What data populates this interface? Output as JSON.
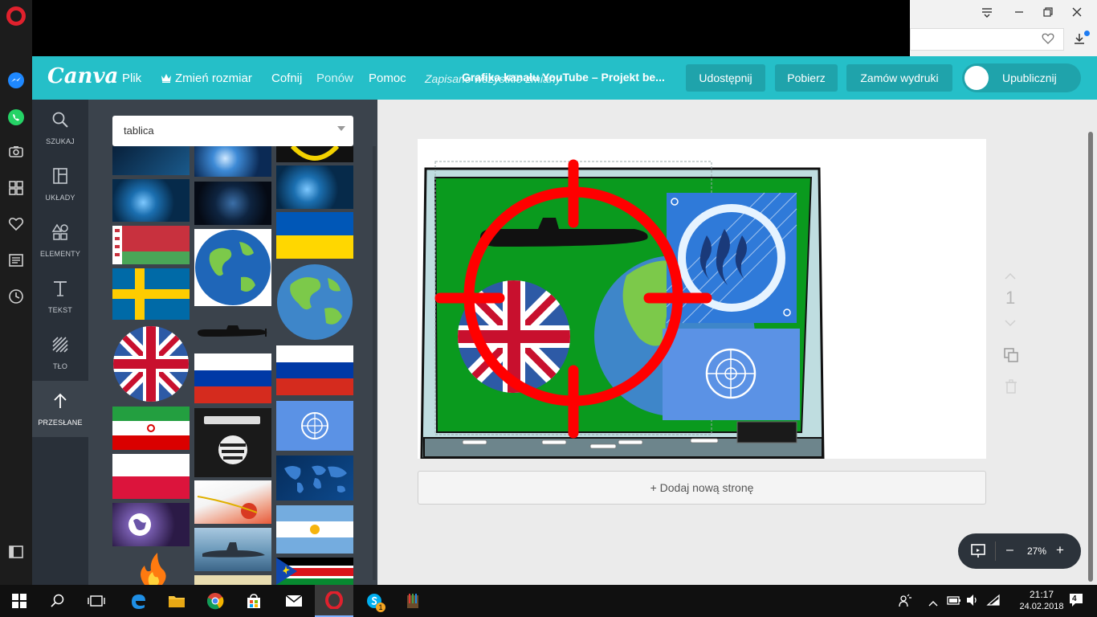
{
  "browser": {
    "accent": "#e0212d"
  },
  "header": {
    "logo": "Canva",
    "menu": {
      "file": "Plik",
      "resize": "Zmień rozmiar",
      "undo": "Cofnij",
      "redo": "Ponów",
      "help": "Pomoc"
    },
    "saved_status": "Zapisano wszystkie zmiany",
    "doc_title": "Grafika kanału YouTube – Projekt be...",
    "buttons": {
      "share": "Udostępnij",
      "download": "Pobierz",
      "order_prints": "Zamów wydruki",
      "publish": "Upublicznij"
    },
    "accent": "#25bfc8"
  },
  "left_nav": {
    "items": [
      {
        "label": "SZUKAJ",
        "icon": "search-icon"
      },
      {
        "label": "UKŁADY",
        "icon": "layouts-icon"
      },
      {
        "label": "ELEMENTY",
        "icon": "elements-icon"
      },
      {
        "label": "TEKST",
        "icon": "text-icon"
      },
      {
        "label": "TŁO",
        "icon": "background-icon"
      },
      {
        "label": "PRZESŁANE",
        "icon": "upload-icon"
      }
    ]
  },
  "panel": {
    "search_value": "tablica"
  },
  "workspace": {
    "page_number": "1",
    "add_page": "+ Dodaj nową stronę",
    "zoom": "27%",
    "zoom_minus": "–",
    "zoom_plus": "+"
  },
  "taskbar": {
    "time": "21:17",
    "date": "24.02.2018",
    "notification_count": "4",
    "skype_badge": "1"
  }
}
